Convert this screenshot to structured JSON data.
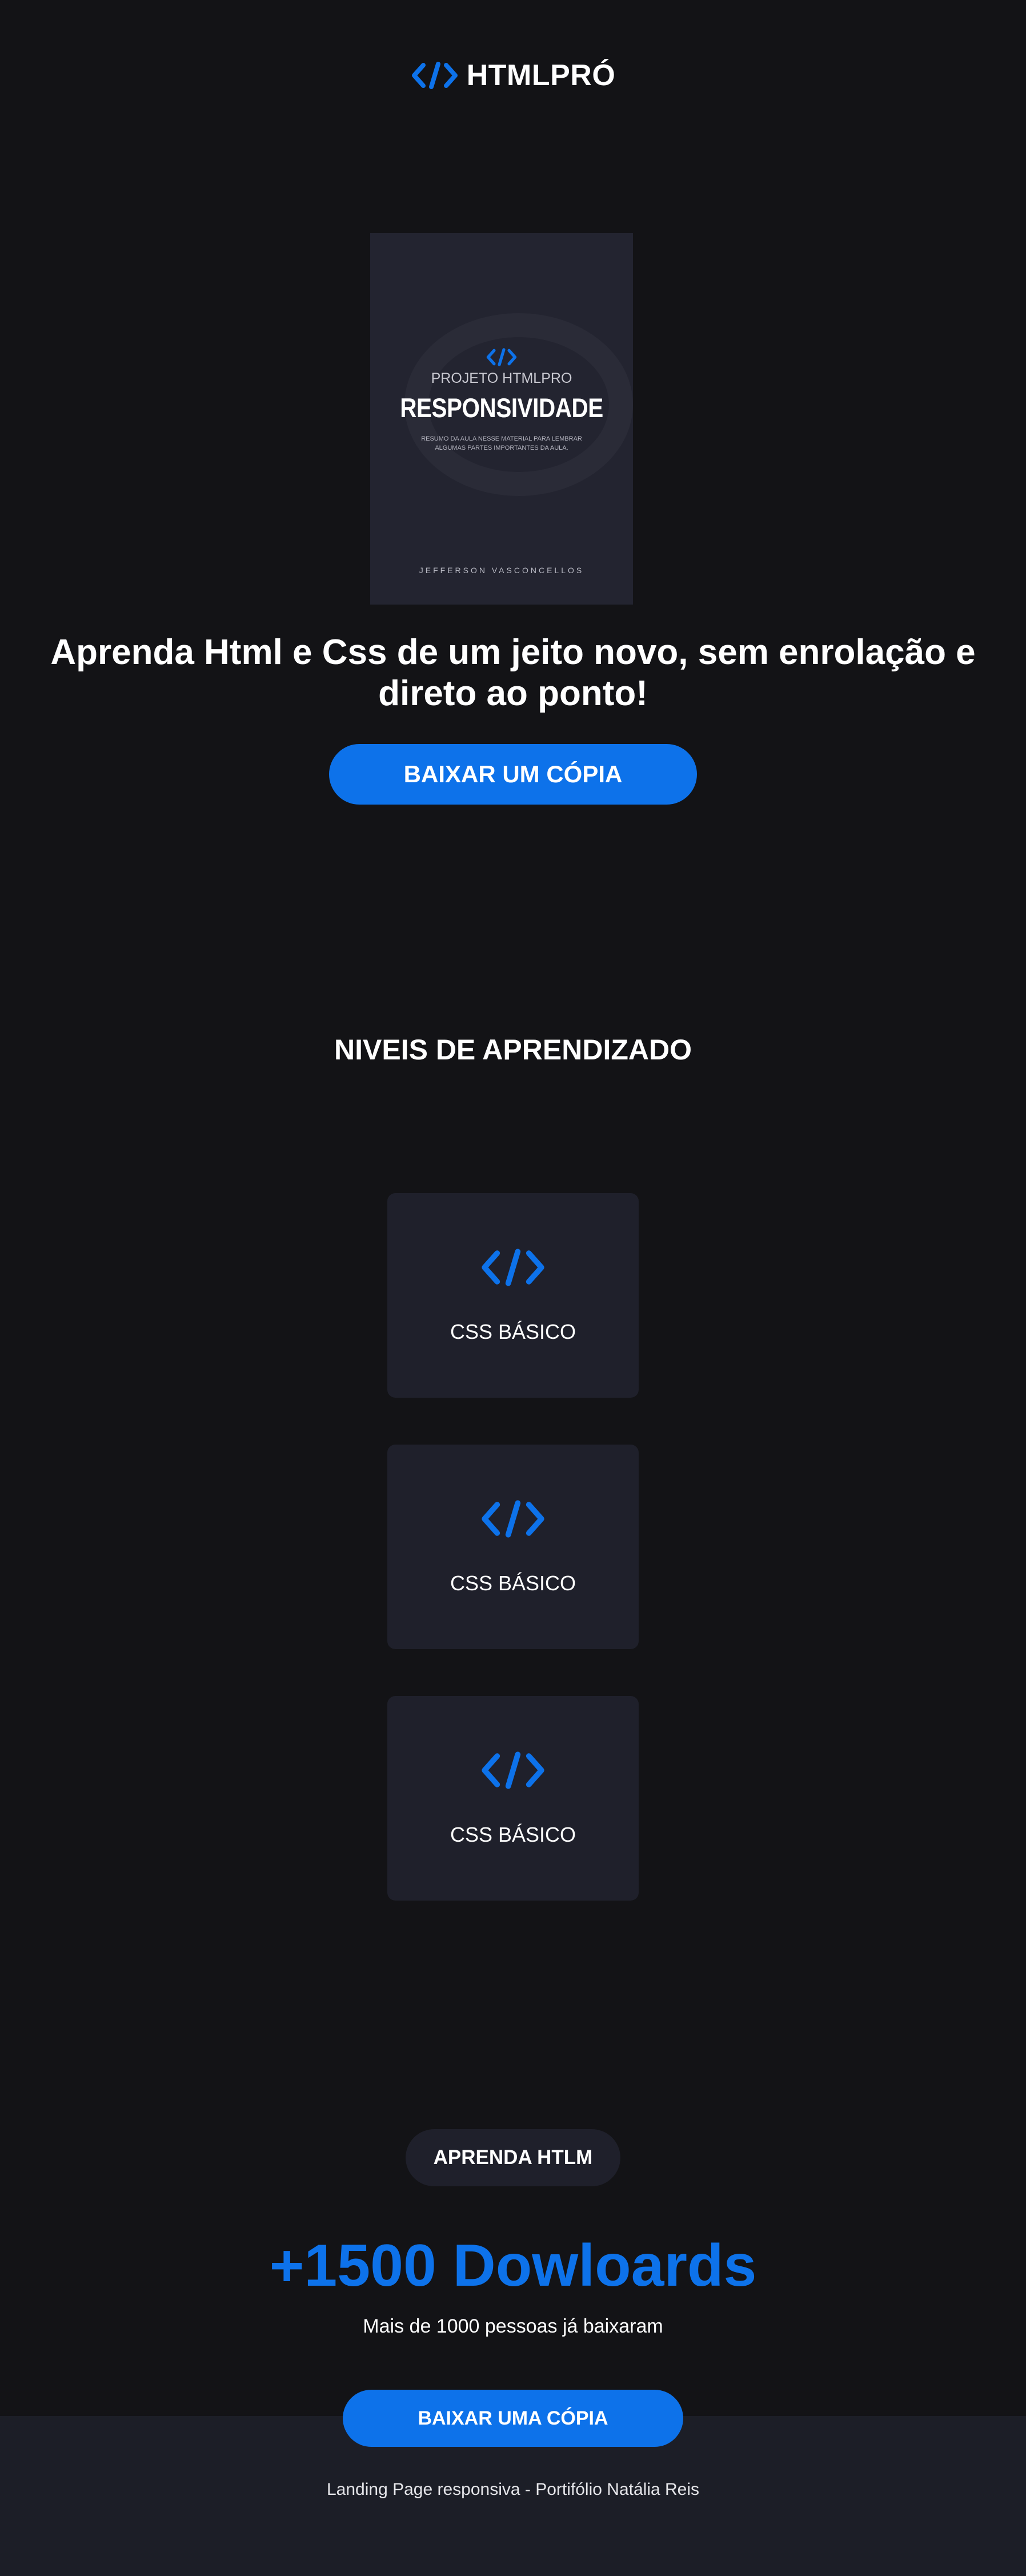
{
  "header": {
    "logo_text": "HTMLPRÓ",
    "logo_icon": "code-icon"
  },
  "book": {
    "pre_title": "PROJETO HTMLPRO",
    "title": "RESPONSIVIDADE",
    "description": "RESUMO DA AULA NESSE MATERIAL PARA LEMBRAR ALGUMAS PARTES IMPORTANTES DA AULA.",
    "author": "JEFFERSON VASCONCELLOS"
  },
  "hero": {
    "title": "Aprenda Html e Css de um jeito novo, sem enrolação e direto ao ponto!",
    "button": "BAIXAR UM CÓPIA"
  },
  "levels": {
    "title": "NIVEIS DE APRENDIZADO",
    "cards": [
      {
        "label": "CSS BÁSICO",
        "icon": "code-icon"
      },
      {
        "label": "CSS BÁSICO",
        "icon": "code-icon"
      },
      {
        "label": "CSS BÁSICO",
        "icon": "code-icon"
      }
    ]
  },
  "stats": {
    "badge": "APRENDA HTLM",
    "number": "+1500 Dowloards",
    "subtitle": "Mais de 1000 pessoas já baixaram",
    "button": "BAIXAR UMA CÓPIA"
  },
  "footer": {
    "text": "Landing Page responsiva - Portifólio Natália Reis"
  },
  "colors": {
    "background": "#131316",
    "accent": "#0d72ea",
    "card": "#1f202b",
    "footer": "#1c1e27"
  }
}
